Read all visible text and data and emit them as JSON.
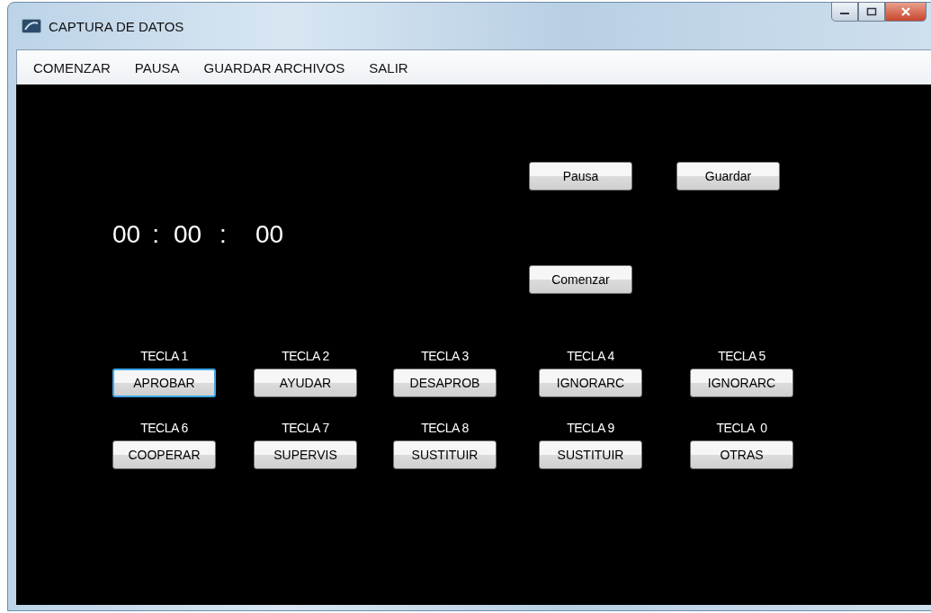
{
  "window": {
    "title": "CAPTURA DE DATOS"
  },
  "menu": [
    {
      "label": "COMENZAR"
    },
    {
      "label": "PAUSA"
    },
    {
      "label": "GUARDAR ARCHIVOS"
    },
    {
      "label": "SALIR"
    }
  ],
  "timer": [
    "00",
    ":",
    "00",
    ":",
    "00"
  ],
  "buttons": [
    {
      "label": "Pausa"
    },
    {
      "label": "Guardar"
    },
    {
      "label": "Comenzar"
    }
  ],
  "keys": [
    {
      "caption": "TECLA 1",
      "label": "APROBAR",
      "focused": true
    },
    {
      "caption": "TECLA 2",
      "label": "AYUDAR",
      "focused": false
    },
    {
      "caption": "TECLA 3",
      "label": "DESAPROB",
      "focused": false
    },
    {
      "caption": "TECLA 4",
      "label": "IGNORARC",
      "focused": false
    },
    {
      "caption": "TECLA 5",
      "label": "IGNORARC",
      "focused": false
    },
    {
      "caption": "TECLA 6",
      "label": "COOPERAR",
      "focused": false
    },
    {
      "caption": "TECLA 7",
      "label": "SUPERVIS",
      "focused": false
    },
    {
      "caption": "TECLA 8",
      "label": "SUSTITUIR",
      "focused": false
    },
    {
      "caption": "TECLA 9",
      "label": "SUSTITUIR",
      "focused": false
    },
    {
      "caption": "TECLA  0",
      "label": "OTRAS",
      "focused": false
    }
  ]
}
